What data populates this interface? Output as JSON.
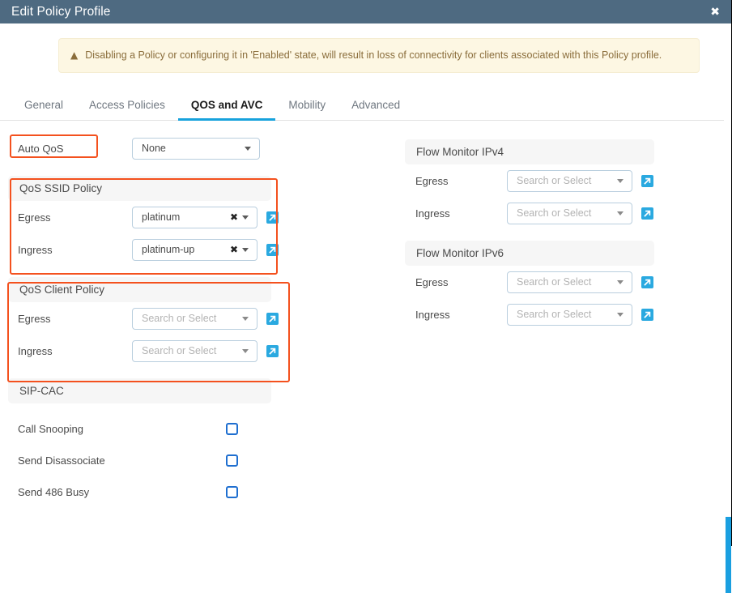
{
  "titlebar": {
    "title": "Edit Policy Profile",
    "close_label": "✖"
  },
  "warning": {
    "icon": "warning-triangle-icon",
    "text": "Disabling a Policy or configuring it in 'Enabled' state, will result in loss of connectivity for clients associated with this Policy profile."
  },
  "tabs": [
    {
      "label": "General",
      "active": false
    },
    {
      "label": "Access Policies",
      "active": false
    },
    {
      "label": "QOS and AVC",
      "active": true
    },
    {
      "label": "Mobility",
      "active": false
    },
    {
      "label": "Advanced",
      "active": false
    }
  ],
  "left": {
    "auto_qos": {
      "label": "Auto QoS",
      "value": "None"
    },
    "qos_ssid_policy": {
      "title": "QoS SSID Policy",
      "rows": [
        {
          "label": "Egress",
          "value": "platinum",
          "placeholder": "Search or Select",
          "clearable": true
        },
        {
          "label": "Ingress",
          "value": "platinum-up",
          "placeholder": "Search or Select",
          "clearable": true
        }
      ]
    },
    "qos_client_policy": {
      "title": "QoS Client Policy",
      "rows": [
        {
          "label": "Egress",
          "value": "",
          "placeholder": "Search or Select",
          "clearable": false
        },
        {
          "label": "Ingress",
          "value": "",
          "placeholder": "Search or Select",
          "clearable": false
        }
      ]
    },
    "sip_cac": {
      "title": "SIP-CAC",
      "rows": [
        {
          "label": "Call Snooping",
          "checked": false
        },
        {
          "label": "Send Disassociate",
          "checked": false
        },
        {
          "label": "Send 486 Busy",
          "checked": false
        }
      ]
    }
  },
  "right": {
    "flow_monitor_ipv4": {
      "title": "Flow Monitor IPv4",
      "rows": [
        {
          "label": "Egress",
          "value": "",
          "placeholder": "Search or Select"
        },
        {
          "label": "Ingress",
          "value": "",
          "placeholder": "Search or Select"
        }
      ]
    },
    "flow_monitor_ipv6": {
      "title": "Flow Monitor IPv6",
      "rows": [
        {
          "label": "Egress",
          "value": "",
          "placeholder": "Search or Select"
        },
        {
          "label": "Ingress",
          "value": "",
          "placeholder": "Search or Select"
        }
      ]
    }
  },
  "annotations": {
    "highlight_color": "#f4511e",
    "highlighted_regions": [
      "Auto QoS",
      "QoS SSID Policy",
      "QoS Client Policy"
    ]
  },
  "colors": {
    "titlebar_bg": "#4e6a81",
    "accent_blue": "#17a2dc",
    "ext_icon_blue": "#2aa9e0",
    "checkbox_blue": "#1f6fd0",
    "warning_bg": "#fdf7e3",
    "warning_text": "#8a6d3b",
    "section_band": "#f6f6f6",
    "scrollbar": "#1a9fe0"
  },
  "icons": {
    "external_link": "external-link-icon",
    "dropdown": "chevron-down-icon",
    "clear": "clear-x-icon"
  }
}
